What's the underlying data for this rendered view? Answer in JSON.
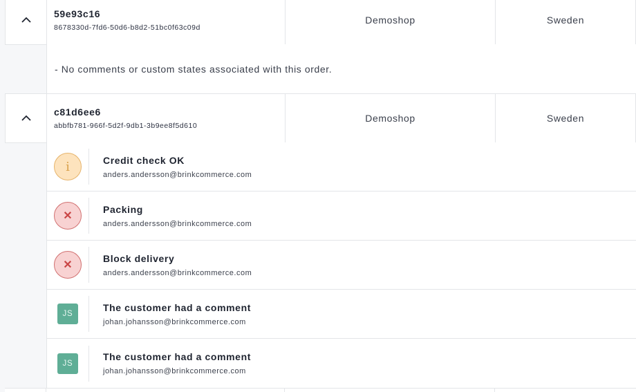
{
  "orders": [
    {
      "ref": "59e93c16",
      "uuid": "8678330d-7fd6-50d6-b8d2-51bc0f63c09d",
      "store": "Demoshop",
      "country": "Sweden",
      "expanded": true,
      "empty_message": "- No comments or custom states associated with this order."
    },
    {
      "ref": "c81d6ee6",
      "uuid": "abbfb781-966f-5d2f-9db1-3b9ee8f5d610",
      "store": "Demoshop",
      "country": "Sweden",
      "expanded": true,
      "comments": [
        {
          "icon": "info-icon",
          "title": "Credit check OK",
          "author": "anders.andersson@brinkcommerce.com"
        },
        {
          "icon": "error-x-icon",
          "title": "Packing",
          "author": "anders.andersson@brinkcommerce.com"
        },
        {
          "icon": "error-x-icon",
          "title": "Block delivery",
          "author": "anders.andersson@brinkcommerce.com"
        },
        {
          "icon": "user-avatar",
          "initials": "JS",
          "title": "The customer had a comment",
          "author": "johan.johansson@brinkcommerce.com"
        },
        {
          "icon": "user-avatar",
          "initials": "JS",
          "title": "The customer had a comment",
          "author": "johan.johansson@brinkcommerce.com"
        }
      ]
    }
  ],
  "icons": {
    "info_glyph": "i",
    "error_glyph": "✕"
  },
  "colors": {
    "info_bg": "#fde3bd",
    "error_bg": "#f8d2d2",
    "avatar_bg": "#5fae96"
  }
}
